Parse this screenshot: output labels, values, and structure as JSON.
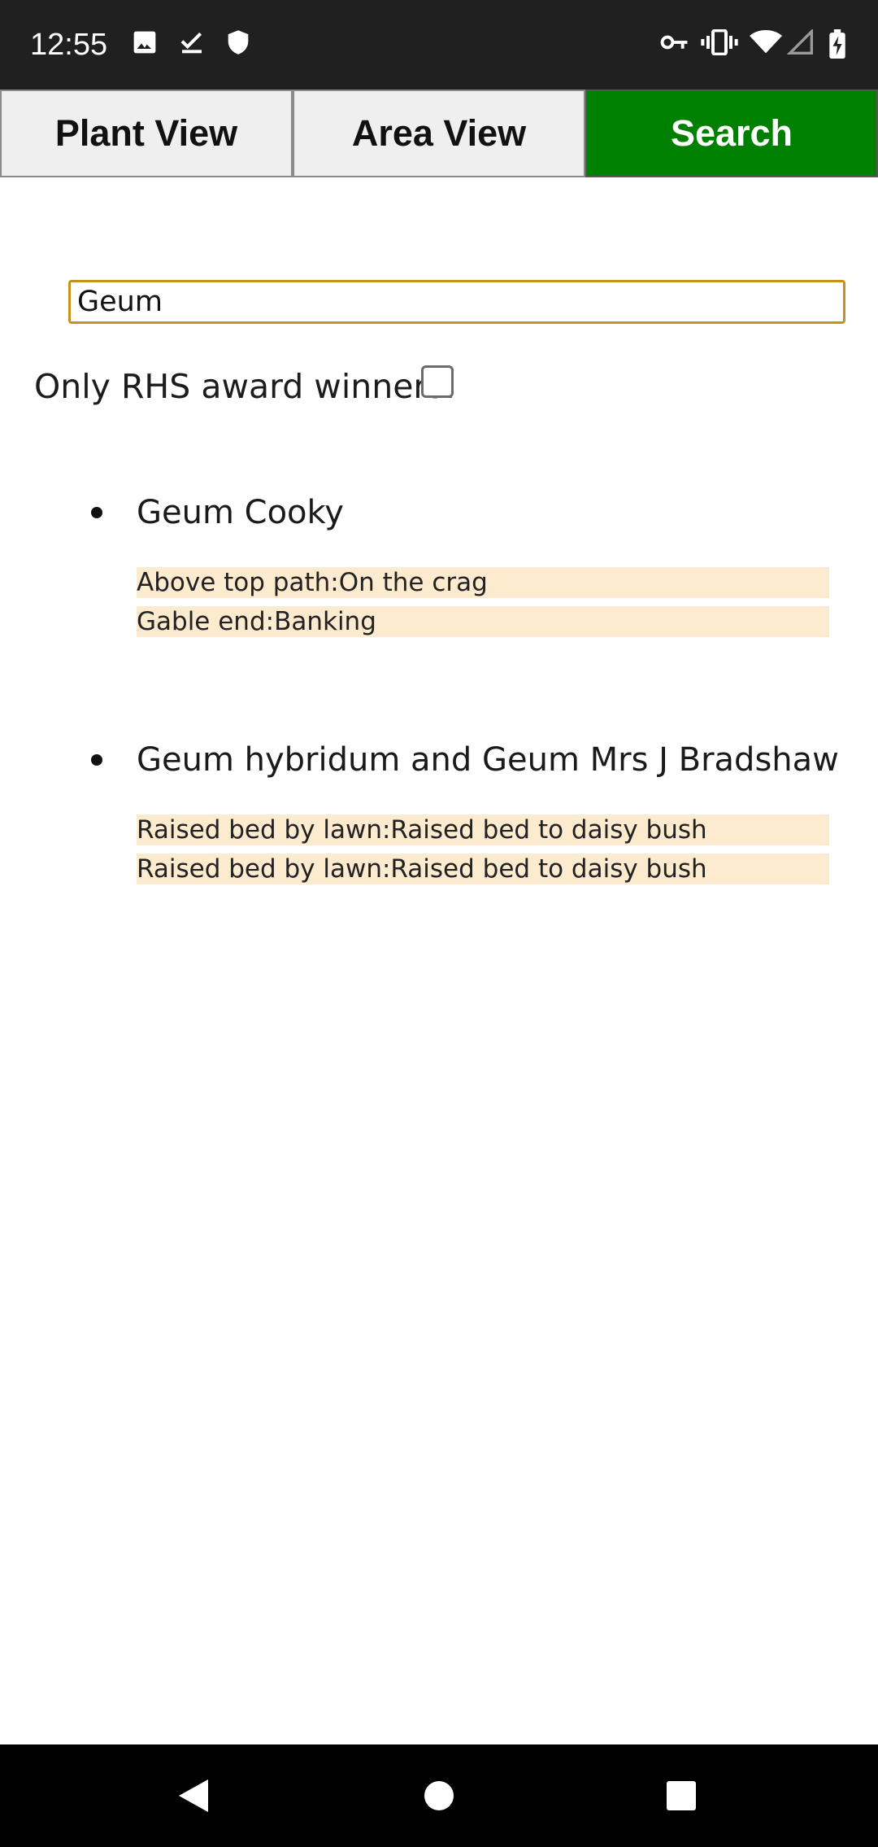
{
  "status_bar": {
    "time": "12:55",
    "icons_left": [
      "image-icon",
      "check-download-icon",
      "shield-icon"
    ],
    "icons_right": [
      "vpn-key-icon",
      "vibrate-icon",
      "wifi-icon",
      "signal-icon",
      "battery-charging-icon"
    ]
  },
  "tabs": [
    {
      "label": "Plant View",
      "active": false
    },
    {
      "label": "Area View",
      "active": false
    },
    {
      "label": "Search",
      "active": true
    }
  ],
  "search": {
    "value": "Geum",
    "placeholder": ""
  },
  "filter": {
    "label": "Only RHS award winners:",
    "checked": false
  },
  "results": [
    {
      "name": "Geum Cooky",
      "locations": [
        "Above top path:On the crag",
        "Gable end:Banking"
      ]
    },
    {
      "name": "Geum hybridum and Geum Mrs J Bradshaw",
      "locations": [
        "Raised bed by lawn:Raised bed to daisy bush",
        "Raised bed by lawn:Raised bed to daisy bush"
      ]
    }
  ],
  "nav_bar": {
    "buttons": [
      "back-icon",
      "home-icon",
      "recents-icon"
    ]
  },
  "colors": {
    "active_tab": "#008000",
    "input_border": "#c8901e",
    "location_bg": "#fdebcf"
  }
}
